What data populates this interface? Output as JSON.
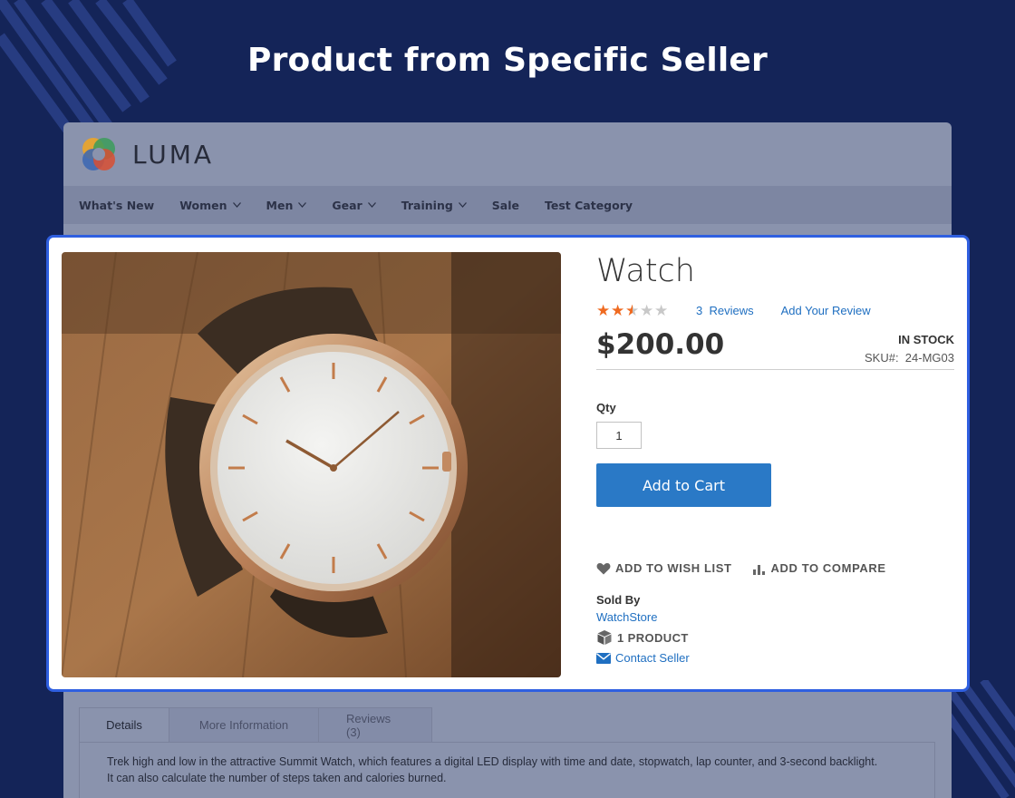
{
  "headline": "Product from Specific Seller",
  "store": {
    "logo_text": "LUMA",
    "nav": [
      {
        "label": "What's New",
        "has_menu": false
      },
      {
        "label": "Women",
        "has_menu": true
      },
      {
        "label": "Men",
        "has_menu": true
      },
      {
        "label": "Gear",
        "has_menu": true
      },
      {
        "label": "Training",
        "has_menu": true
      },
      {
        "label": "Sale",
        "has_menu": false
      },
      {
        "label": "Test Category",
        "has_menu": false
      }
    ]
  },
  "product": {
    "title": "Watch",
    "rating": {
      "value": 2.5,
      "max": 5
    },
    "reviews_label": "3  Reviews",
    "add_review_label": "Add Your Review",
    "price": "$200.00",
    "stock": "IN STOCK",
    "sku": "SKU#:  24-MG03",
    "qty_label": "Qty",
    "qty_value": "1",
    "add_to_cart": "Add to Cart",
    "wishlist": "ADD TO WISH LIST",
    "compare": "ADD TO COMPARE"
  },
  "seller": {
    "sold_by_label": "Sold By",
    "name": "WatchStore",
    "product_count": "1 PRODUCT",
    "contact": "Contact Seller"
  },
  "tabs": [
    {
      "label": "Details",
      "active": true
    },
    {
      "label": "More Information",
      "active": false
    },
    {
      "label": "Reviews (3)",
      "active": false
    }
  ],
  "details_text": [
    "Trek high and low in the attractive Summit Watch, which features a digital LED display with time and date, stopwatch, lap counter, and 3-second backlight.",
    "It can also calculate the number of steps taken and calories burned."
  ],
  "colors": {
    "background": "#142458",
    "highlight_border": "#2f5fe0",
    "cart_button": "#2a79c6",
    "link": "#1f6fc1",
    "star": "#ef6a20"
  }
}
